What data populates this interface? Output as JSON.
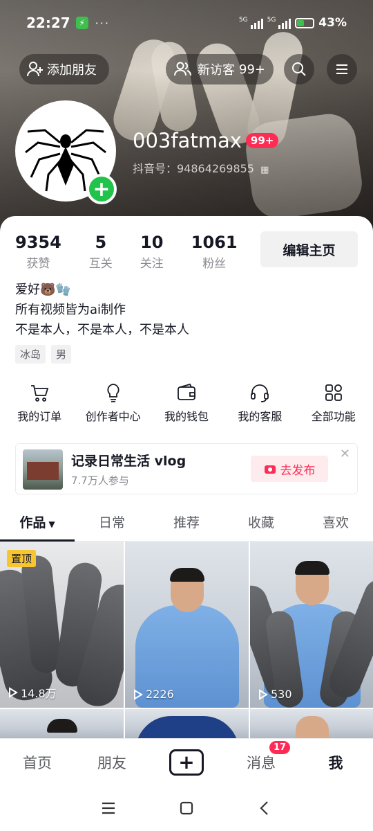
{
  "status": {
    "time": "22:27",
    "net1": "5G",
    "net2": "5G",
    "battery": "43%"
  },
  "header": {
    "add_friend": "添加朋友",
    "visitors": "新访客",
    "visitors_count": "99+",
    "username": "003fatmax",
    "username_badge": "99+",
    "douyin_id": "抖音号：94864269855"
  },
  "stats": [
    {
      "value": "9354",
      "label": "获赞"
    },
    {
      "value": "5",
      "label": "互关"
    },
    {
      "value": "10",
      "label": "关注"
    },
    {
      "value": "1061",
      "label": "粉丝"
    }
  ],
  "edit_button": "编辑主页",
  "bio": {
    "line1": "爱好🐻🧤",
    "line2": "所有视频皆为ai制作",
    "line3": "不是本人，不是本人，不是本人"
  },
  "tags": [
    "冰岛",
    "男"
  ],
  "functions": [
    {
      "label": "我的订单",
      "icon": "cart-icon"
    },
    {
      "label": "创作者中心",
      "icon": "lightbulb-icon"
    },
    {
      "label": "我的钱包",
      "icon": "wallet-icon"
    },
    {
      "label": "我的客服",
      "icon": "headset-icon"
    },
    {
      "label": "全部功能",
      "icon": "grid-icon"
    }
  ],
  "vlog": {
    "title": "记录日常生活 vlog",
    "participants": "7.7万人参与",
    "publish": "去发布"
  },
  "tabs": [
    "作品",
    "日常",
    "推荐",
    "收藏",
    "喜欢"
  ],
  "videos": [
    {
      "pinned": "置顶",
      "plays": "14.8万"
    },
    {
      "plays": "2226"
    },
    {
      "plays": "530"
    }
  ],
  "bottom_nav": {
    "home": "首页",
    "friends": "朋友",
    "messages": "消息",
    "messages_badge": "17",
    "me": "我"
  }
}
